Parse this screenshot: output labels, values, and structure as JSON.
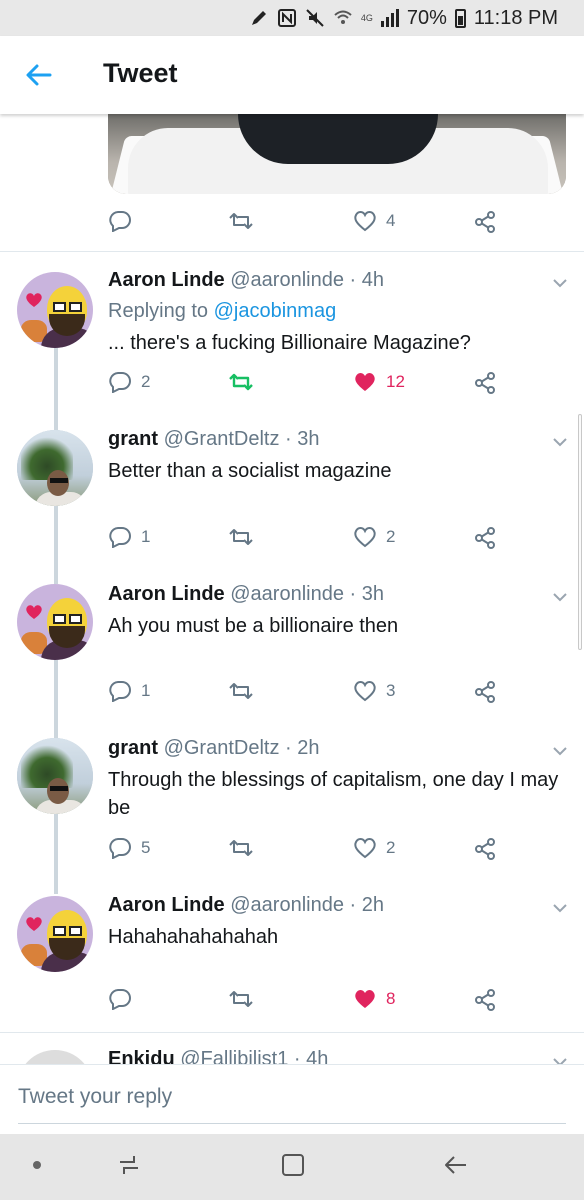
{
  "status_bar": {
    "battery": "70%",
    "time": "11:18 PM",
    "icons": [
      "pen-icon",
      "nfc-icon",
      "mute-icon",
      "wifi-icon",
      "volte-icon",
      "signal-icon",
      "battery-icon"
    ]
  },
  "header": {
    "back_icon": "back-arrow-icon",
    "title": "Tweet"
  },
  "top_actions": {
    "reply_count": "",
    "retweet_count": "",
    "like_count": "4"
  },
  "tweets": [
    {
      "name": "Aaron Linde",
      "handle": "@aaronlinde",
      "time": "· 4h",
      "replying_prefix": "Replying to",
      "replying_to": "@jacobinmag",
      "text": "... there's a fucking Billionaire Magazine?",
      "reply_count": "2",
      "retweet_count": "",
      "like_count": "12",
      "liked": true,
      "retweeted": true
    },
    {
      "name": "grant",
      "handle": "@GrantDeltz",
      "time": "· 3h",
      "text": "Better than a socialist magazine",
      "reply_count": "1",
      "retweet_count": "",
      "like_count": "2",
      "liked": false
    },
    {
      "name": "Aaron Linde",
      "handle": "@aaronlinde",
      "time": "· 3h",
      "text": "Ah you must be a billionaire then",
      "reply_count": "1",
      "retweet_count": "",
      "like_count": "3",
      "liked": false
    },
    {
      "name": "grant",
      "handle": "@GrantDeltz",
      "time": "· 2h",
      "text": "Through the blessings of capitalism, one day I may be",
      "reply_count": "5",
      "retweet_count": "",
      "like_count": "2",
      "liked": false
    },
    {
      "name": "Aaron Linde",
      "handle": "@aaronlinde",
      "time": "· 2h",
      "text": "Hahahahahahahah",
      "reply_count": "",
      "retweet_count": "",
      "like_count": "8",
      "liked": true
    },
    {
      "name": "Enkidu",
      "handle": "@Fallibilist1",
      "time": "· 4h"
    }
  ],
  "reply_bar": {
    "placeholder": "Tweet your reply"
  },
  "nav_bar": {
    "icons": [
      "dot-icon",
      "recent-apps-icon",
      "home-icon",
      "back-icon"
    ]
  },
  "colors": {
    "accent": "#1da1f2",
    "like": "#e0245e",
    "retweet": "#17bf63",
    "muted": "#657786"
  }
}
